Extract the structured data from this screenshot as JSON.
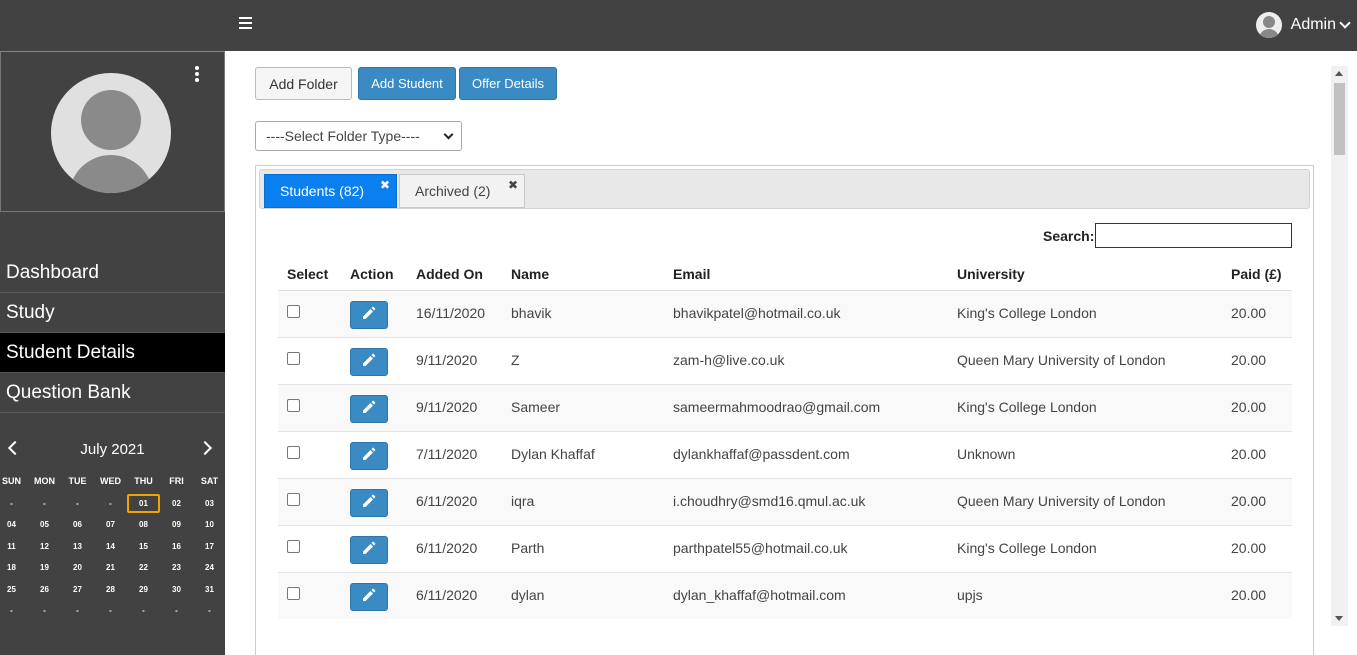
{
  "header": {
    "user_name": "Admin"
  },
  "sidebar": {
    "nav": [
      {
        "label": "Dashboard",
        "active": false
      },
      {
        "label": "Study",
        "active": false
      },
      {
        "label": "Student Details",
        "active": true
      },
      {
        "label": "Question Bank",
        "active": false
      }
    ]
  },
  "calendar": {
    "month_label": "July 2021",
    "days_of_week": [
      "SUN",
      "MON",
      "TUE",
      "WED",
      "THU",
      "FRI",
      "SAT"
    ],
    "weeks": [
      [
        "-",
        "-",
        "-",
        "-",
        "01",
        "02",
        "03"
      ],
      [
        "04",
        "05",
        "06",
        "07",
        "08",
        "09",
        "10"
      ],
      [
        "11",
        "12",
        "13",
        "14",
        "15",
        "16",
        "17"
      ],
      [
        "18",
        "19",
        "20",
        "21",
        "22",
        "23",
        "24"
      ],
      [
        "25",
        "26",
        "27",
        "28",
        "29",
        "30",
        "31"
      ],
      [
        "-",
        "-",
        "-",
        "-",
        "-",
        "-",
        "-"
      ]
    ],
    "today": "01"
  },
  "toolbar": {
    "add_folder": "Add Folder",
    "add_student": "Add Student",
    "offer_details": "Offer Details",
    "folder_select": "----Select Folder Type----"
  },
  "tabs": [
    {
      "label": "Students (82)",
      "active": true
    },
    {
      "label": "Archived (2)",
      "active": false
    }
  ],
  "search": {
    "label": "Search:",
    "value": ""
  },
  "table": {
    "headers": [
      "Select",
      "Action",
      "Added On",
      "Name",
      "Email",
      "University",
      "Paid (£)"
    ],
    "rows": [
      {
        "added_on": "16/11/2020",
        "name": "bhavik",
        "email": "bhavikpatel@hotmail.co.uk",
        "university": "King's College London",
        "paid": "20.00"
      },
      {
        "added_on": "9/11/2020",
        "name": "Z",
        "email": "zam-h@live.co.uk",
        "university": "Queen Mary University of London",
        "paid": "20.00"
      },
      {
        "added_on": "9/11/2020",
        "name": "Sameer",
        "email": "sameermahmoodrao@gmail.com",
        "university": "King's College London",
        "paid": "20.00"
      },
      {
        "added_on": "7/11/2020",
        "name": "Dylan Khaffaf",
        "email": "dylankhaffaf@passdent.com",
        "university": "Unknown",
        "paid": "20.00"
      },
      {
        "added_on": "6/11/2020",
        "name": "iqra",
        "email": "i.choudhry@smd16.qmul.ac.uk",
        "university": "Queen Mary University of London",
        "paid": "20.00"
      },
      {
        "added_on": "6/11/2020",
        "name": "Parth",
        "email": "parthpatel55@hotmail.co.uk",
        "university": "King's College London",
        "paid": "20.00"
      },
      {
        "added_on": "6/11/2020",
        "name": "dylan",
        "email": "dylan_khaffaf@hotmail.com",
        "university": "upjs",
        "paid": "20.00"
      }
    ]
  },
  "colors": {
    "primary": "#3a8bc4",
    "tab_active": "#0a7ff0",
    "dark": "#424242",
    "today_outline": "#f0a400"
  }
}
